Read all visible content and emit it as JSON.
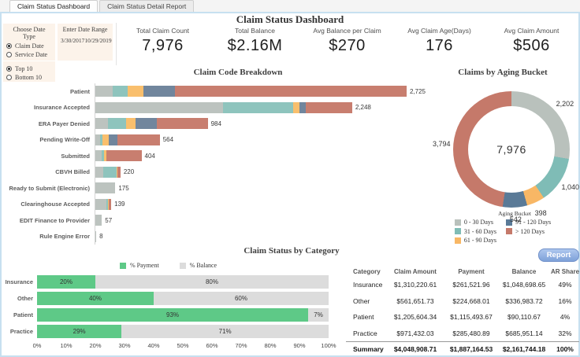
{
  "window": {
    "tabs": [
      {
        "label": "Claim Status Dashboard",
        "active": true
      },
      {
        "label": "Claim Status Detail Report",
        "active": false
      }
    ]
  },
  "header": {
    "title": "Claim Status Dashboard"
  },
  "filters": {
    "date_type": {
      "label": "Choose Date Type",
      "options": [
        {
          "label": "Claim Date",
          "selected": true
        },
        {
          "label": "Service Date",
          "selected": false
        }
      ]
    },
    "date_range": {
      "label": "Enter Date Range",
      "start": "3/30/2017",
      "end": "10/29/2019"
    },
    "top_bottom": {
      "options": [
        {
          "label": "Top 10",
          "selected": true
        },
        {
          "label": "Bottom 10",
          "selected": false
        }
      ]
    }
  },
  "kpis": [
    {
      "label": "Total Claim Count",
      "value": "7,976"
    },
    {
      "label": "Total Balance",
      "value": "$2.16M"
    },
    {
      "label": "Avg Balance per Claim",
      "value": "$270"
    },
    {
      "label": "Avg Claim Age(Days)",
      "value": "176"
    },
    {
      "label": "Avg Claim Amount",
      "value": "$506"
    }
  ],
  "report_button": {
    "label": "Report"
  },
  "colors": {
    "bar_buckets": [
      "#bcc3bf",
      "#8ec4bd",
      "#f9bf6d",
      "#71869d",
      "#c87e6f"
    ],
    "donut_buckets": [
      "#b9c1bc",
      "#7fbcb6",
      "#f8b765",
      "#5a7a97",
      "#c5796a"
    ],
    "payment_green": "#5ec987",
    "balance_gray": "#dcdcdc",
    "accent_border": "#c7e0f0",
    "report_blue": "#7ea1d9"
  },
  "chart_data": [
    {
      "id": "claim_code_breakdown",
      "type": "bar",
      "stacked": true,
      "title": "Claim Code Breakdown",
      "orientation": "horizontal",
      "xlim": [
        0,
        2725
      ],
      "legend": "none",
      "series_names": [
        "0 - 30 Days",
        "31 - 60 Days",
        "61 - 90 Days",
        "91 - 120 Days",
        "> 120 Days"
      ],
      "categories": [
        "Patient",
        "Insurance Accepted",
        "ERA Payer Denied",
        "Pending Write-Off",
        "Submitted",
        "CBVH Billed",
        "Ready to Submit (Electronic)",
        "Clearinghouse Accepted",
        "EDIT Finance to Provider",
        "Rule Engine Error"
      ],
      "totals": [
        2725,
        2248,
        984,
        564,
        404,
        220,
        175,
        139,
        57,
        8
      ],
      "total_labels": [
        "2,725",
        "2,248",
        "984",
        "564",
        "404",
        "220",
        "175",
        "139",
        "57",
        "8"
      ],
      "segments_estimated": [
        [
          150,
          130,
          140,
          280,
          2025
        ],
        [
          1120,
          615,
          55,
          50,
          408
        ],
        [
          110,
          160,
          80,
          190,
          444
        ],
        [
          40,
          25,
          55,
          70,
          374
        ],
        [
          55,
          20,
          20,
          0,
          309
        ],
        [
          70,
          115,
          10,
          0,
          25
        ],
        [
          175,
          0,
          0,
          0,
          0
        ],
        [
          95,
          12,
          10,
          0,
          22
        ],
        [
          57,
          0,
          0,
          0,
          0
        ],
        [
          8,
          0,
          0,
          0,
          0
        ]
      ]
    },
    {
      "id": "claims_by_aging_bucket",
      "type": "pie",
      "subtype": "donut",
      "title": "Claims by Aging Bucket",
      "center_label": "7,976",
      "legend_title": "Aging Bucket",
      "legend_position": "bottom",
      "slices": [
        {
          "label": "0 - 30 Days",
          "value": 2202,
          "display": "2,202"
        },
        {
          "label": "31 - 60 Days",
          "value": 1040,
          "display": "1,040"
        },
        {
          "label": "61 - 90 Days",
          "value": 398,
          "display": "398"
        },
        {
          "label": "91 - 120 Days",
          "value": 542,
          "display": "542"
        },
        {
          "label": "> 120 Days",
          "value": 3794,
          "display": "3,794"
        }
      ]
    },
    {
      "id": "claim_status_by_category",
      "type": "bar",
      "stacked": true,
      "title": "Claim Status by Category",
      "orientation": "horizontal",
      "xlim": [
        0,
        100
      ],
      "categories": [
        "Insurance",
        "Other",
        "Patient",
        "Practice"
      ],
      "series": [
        {
          "name": "% Payment",
          "values": [
            20,
            40,
            93,
            29
          ]
        },
        {
          "name": "% Balance",
          "values": [
            80,
            60,
            7,
            71
          ]
        }
      ],
      "bar_labels": [
        [
          "20%",
          "80%"
        ],
        [
          "40%",
          "60%"
        ],
        [
          "93%",
          "7%"
        ],
        [
          "29%",
          "71%"
        ]
      ],
      "x_ticks": [
        "0%",
        "10%",
        "20%",
        "30%",
        "40%",
        "50%",
        "60%",
        "70%",
        "80%",
        "90%",
        "100%"
      ],
      "legend_position": "top"
    }
  ],
  "table": {
    "columns": [
      "Category",
      "Claim Amount",
      "Payment",
      "Balance",
      "AR Share %"
    ],
    "rows": [
      [
        "Insurance",
        "$1,310,220.61",
        "$261,521.96",
        "$1,048,698.65",
        "49%"
      ],
      [
        "Other",
        "$561,651.73",
        "$224,668.01",
        "$336,983.72",
        "16%"
      ],
      [
        "Patient",
        "$1,205,604.34",
        "$1,115,493.67",
        "$90,110.67",
        "4%"
      ],
      [
        "Practice",
        "$971,432.03",
        "$285,480.89",
        "$685,951.14",
        "32%"
      ]
    ],
    "summary": [
      "Summary",
      "$4,048,908.71",
      "$1,887,164.53",
      "$2,161,744.18",
      "100%"
    ]
  }
}
